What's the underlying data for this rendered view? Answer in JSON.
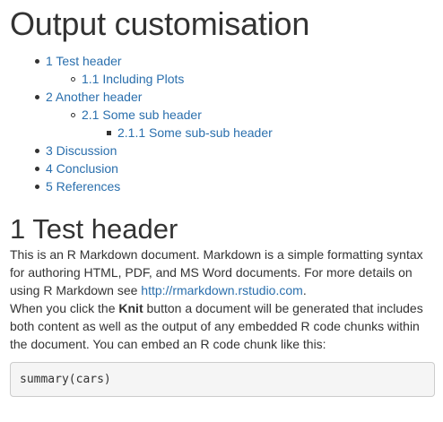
{
  "document": {
    "title": "Output customisation"
  },
  "toc": [
    {
      "level": 1,
      "label": "1 Test header"
    },
    {
      "level": 2,
      "label": "1.1 Including Plots"
    },
    {
      "level": 1,
      "label": "2 Another header"
    },
    {
      "level": 2,
      "label": "2.1 Some sub header"
    },
    {
      "level": 3,
      "label": "2.1.1 Some sub-sub header"
    },
    {
      "level": 1,
      "label": "3 Discussion"
    },
    {
      "level": 1,
      "label": "4 Conclusion"
    },
    {
      "level": 1,
      "label": "5 References"
    }
  ],
  "section1": {
    "heading": "1 Test header",
    "para1_text": "This is an R Markdown document. Markdown is a simple formatting syntax for authoring HTML, PDF, and MS Word documents. For more details on using R Markdown see ",
    "para1_link": "http://rmarkdown.rstudio.com",
    "para1_end": ".",
    "para2_before": "When you click the ",
    "para2_bold": "Knit",
    "para2_after": " button a document will be generated that includes both content as well as the output of any embedded R code chunks within the document. You can embed an R code chunk like this:",
    "code": "summary(cars)"
  },
  "colors": {
    "link": "#2a6fad",
    "text": "#333333",
    "code_background": "#f5f5f5",
    "code_border": "#cccccc"
  }
}
